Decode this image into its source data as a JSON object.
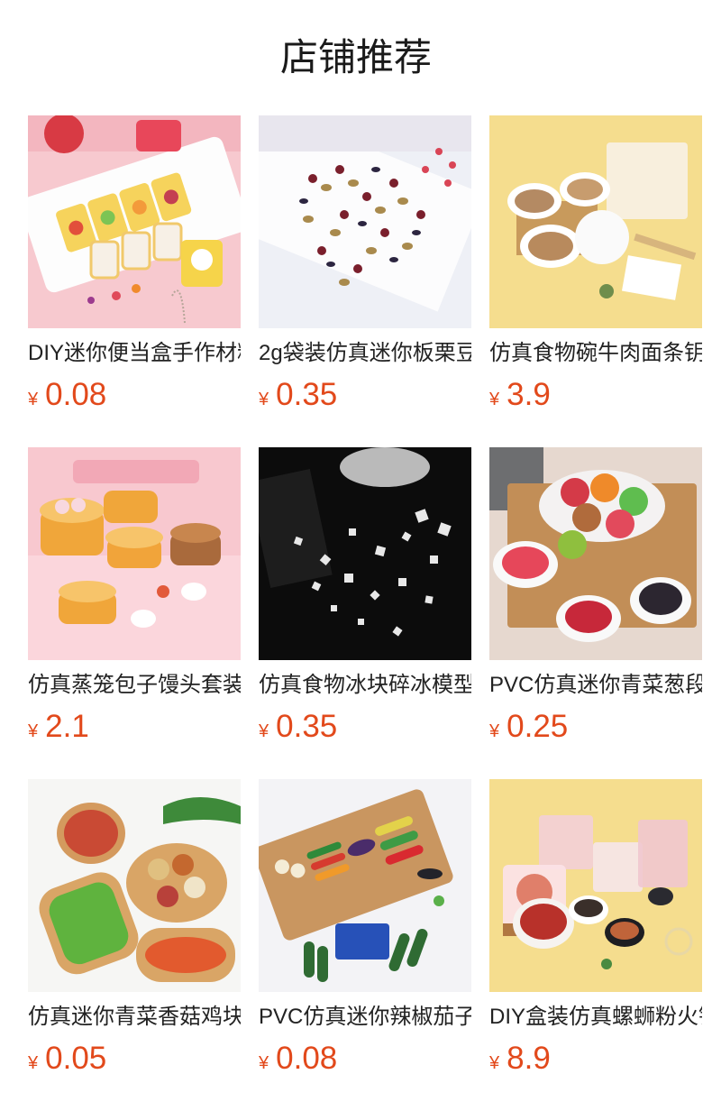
{
  "section_title": "店铺推荐",
  "currency_symbol": "¥",
  "products": [
    {
      "name": "DIY迷你便当盒手作材料",
      "price": "0.08",
      "image": "bento-box-photo"
    },
    {
      "name": "2g袋装仿真迷你板栗豆",
      "price": "0.35",
      "image": "beans-plate-photo"
    },
    {
      "name": "仿真食物碗牛肉面条钥匙扣",
      "price": "3.9",
      "image": "noodle-bowls-photo"
    },
    {
      "name": "仿真蒸笼包子馒头套装",
      "price": "2.1",
      "image": "steamed-buns-photo"
    },
    {
      "name": "仿真食物冰块碎冰模型",
      "price": "0.35",
      "image": "ice-cubes-photo"
    },
    {
      "name": "PVC仿真迷你青菜葱段",
      "price": "0.25",
      "image": "veggie-plate-photo"
    },
    {
      "name": "仿真迷你青菜香菇鸡块",
      "price": "0.05",
      "image": "wooden-trays-photo"
    },
    {
      "name": "PVC仿真迷你辣椒茄子",
      "price": "0.08",
      "image": "vegetable-board-photo"
    },
    {
      "name": "DIY盒装仿真螺蛳粉火锅",
      "price": "8.9",
      "image": "snail-noodle-photo"
    }
  ]
}
